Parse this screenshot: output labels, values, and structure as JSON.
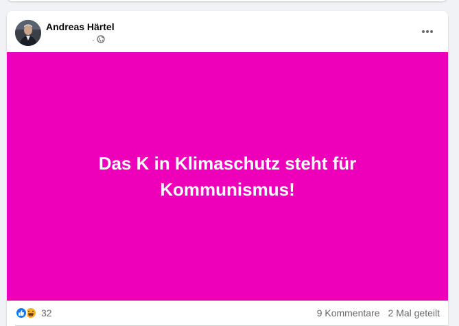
{
  "post": {
    "author_name": "Andreas Härtel",
    "timestamp": "",
    "meta_separator": "·",
    "privacy_icon": "globe-icon",
    "menu_icon": "more-horizontal-icon",
    "image": {
      "background_color": "#ee00bb",
      "text": "Das K in Klimaschutz steht für Kommunismus!"
    },
    "stats": {
      "reaction_icons": [
        "like-icon",
        "haha-icon"
      ],
      "reaction_count": "32",
      "comments": "9 Kommentare",
      "shares": "2 Mal geteilt"
    },
    "actions": [
      {
        "icon": "like-icon",
        "label": ""
      },
      {
        "icon": "comment-icon",
        "label": ""
      },
      {
        "icon": "share-icon",
        "label": ""
      }
    ]
  },
  "colors": {
    "like_blue": "#1877f2",
    "haha_yellow": "#f7b125",
    "secondary_text": "#65676b"
  }
}
